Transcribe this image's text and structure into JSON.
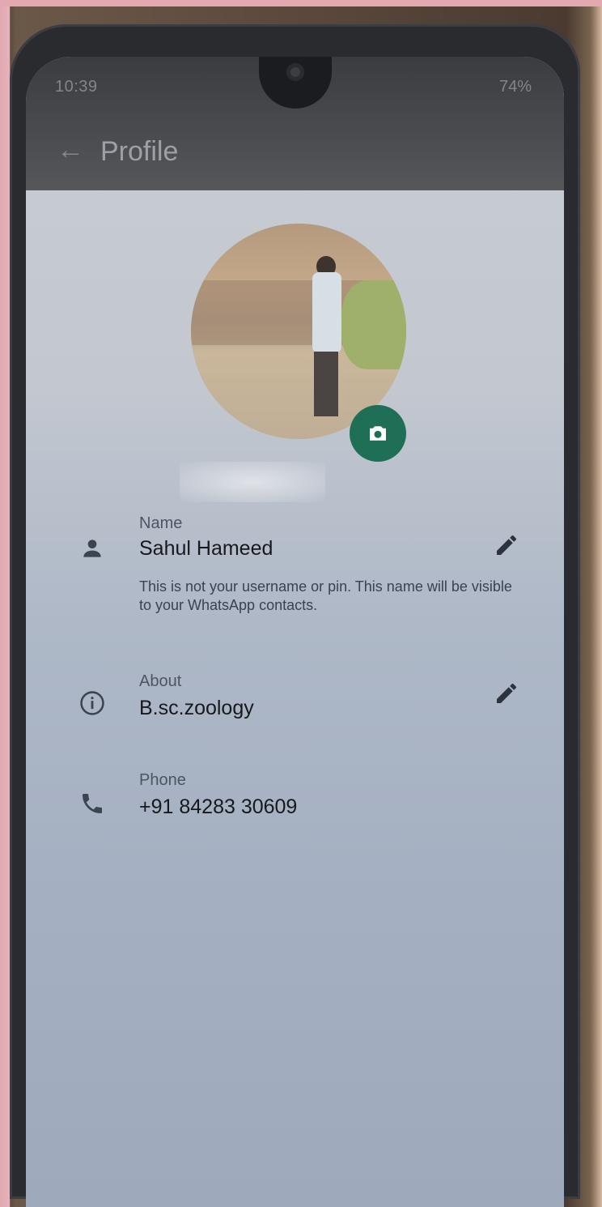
{
  "status_bar": {
    "time": "10:39",
    "right_icons": "74%"
  },
  "app_bar": {
    "title": "Profile"
  },
  "profile": {
    "name_label": "Name",
    "name_value": "Sahul Hameed",
    "name_hint": "This is not your username or pin. This name will be visible to your WhatsApp contacts.",
    "about_label": "About",
    "about_value": "B.sc.zoology",
    "phone_label": "Phone",
    "phone_value": "+91 84283 30609"
  },
  "colors": {
    "accent": "#1f6f57"
  }
}
